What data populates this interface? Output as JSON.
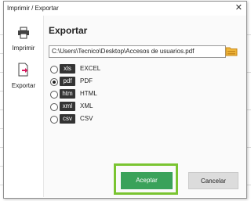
{
  "window": {
    "title": "Imprimir / Exportar",
    "close_glyph": "✕"
  },
  "sidebar": {
    "items": [
      {
        "label": "Imprimir",
        "icon": "printer-icon"
      },
      {
        "label": "Exportar",
        "icon": "export-icon"
      }
    ]
  },
  "main": {
    "title": "Exportar",
    "path_value": "C:\\Users\\Tecnico\\Desktop\\Accesos de usuarios.pdf",
    "folder_icon": "folder-icon",
    "formats": [
      {
        "badge": "xls",
        "label": "EXCEL",
        "checked": false
      },
      {
        "badge": "pdf",
        "label": "PDF",
        "checked": true
      },
      {
        "badge": "htm",
        "label": "HTML",
        "checked": false
      },
      {
        "badge": "xml",
        "label": "XML",
        "checked": false
      },
      {
        "badge": "csv",
        "label": "CSV",
        "checked": false
      }
    ]
  },
  "buttons": {
    "accept": "Aceptar",
    "cancel": "Cancelar"
  },
  "colors": {
    "accept_bg": "#3aa25a",
    "highlight": "#7ac431",
    "badge_bg": "#333333"
  }
}
